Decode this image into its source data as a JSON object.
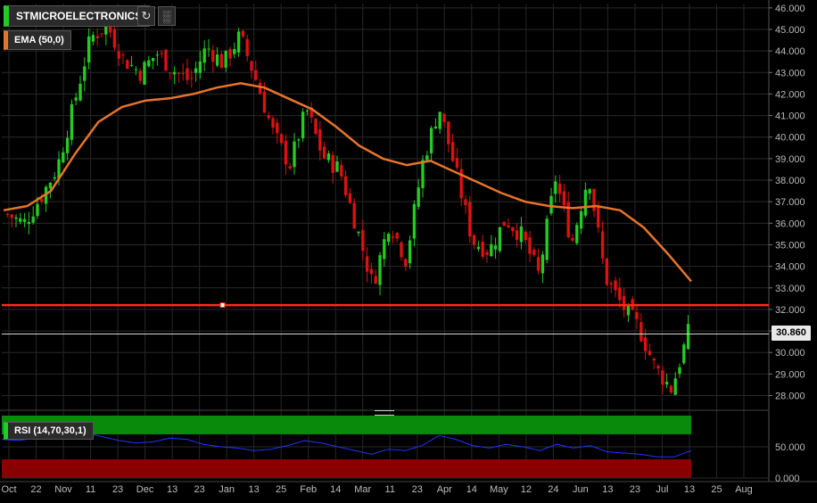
{
  "toolbar": {
    "symbol": "STMICROELECTRONICS",
    "refresh_icon": "refresh-icon",
    "chart_settings_icon": "chart-settings-icon",
    "accent": "#22cc22"
  },
  "indicators": {
    "ema_label": "EMA (50,0)",
    "ema_color": "#e8742a",
    "rsi_label": "RSI (14,70,30,1)",
    "rsi_color": "#2233ff"
  },
  "last_price_label": "30.860",
  "chart_data": [
    {
      "type": "candlestick",
      "title": "STMICROELECTRONICS",
      "y_axis_side": "right",
      "ylim": [
        27.4,
        46.2
      ],
      "y_ticks": [
        "28.000",
        "29.000",
        "30.000",
        "31.000",
        "32.000",
        "33.000",
        "34.000",
        "35.000",
        "36.000",
        "37.000",
        "38.000",
        "39.000",
        "40.000",
        "41.000",
        "42.000",
        "43.000",
        "44.000",
        "45.000",
        "46.000"
      ],
      "x_tick_labels": [
        "Oct",
        "22",
        "Nov",
        "11",
        "23",
        "Dec",
        "13",
        "23",
        "Jan",
        "13",
        "25",
        "Feb",
        "14",
        "Mar",
        "11",
        "23",
        "Apr",
        "14",
        "May",
        "12",
        "24",
        "Jun",
        "13",
        "23",
        "Jul",
        "13",
        "25",
        "Aug"
      ],
      "up_color": "#22cc22",
      "down_color": "#dd1111",
      "grid": true,
      "horizontal_level": 32.2,
      "horizontal_level_color": "#ff2a1a",
      "last_price": 30.86,
      "close_path_points": [
        36.4,
        36.0,
        37.2,
        38.6,
        41.5,
        44.6,
        45.2,
        43.6,
        43.0,
        43.9,
        43.1,
        42.6,
        44.2,
        43.4,
        44.7,
        42.6,
        40.2,
        38.7,
        41.3,
        39.1,
        38.5,
        35.9,
        33.1,
        36.1,
        34.3,
        38.8,
        41.4,
        38.4,
        35.2,
        34.7,
        36.2,
        35.4,
        33.6,
        38.1,
        35.1,
        38.3,
        33.5,
        32.2,
        31.2,
        29.3,
        28.3,
        30.9
      ],
      "ema_path_points": [
        36.6,
        36.8,
        37.5,
        39.2,
        40.7,
        41.4,
        41.7,
        41.8,
        42.0,
        42.3,
        42.5,
        42.3,
        41.8,
        41.3,
        40.5,
        39.6,
        39.0,
        38.7,
        38.9,
        38.4,
        37.9,
        37.4,
        37.0,
        36.8,
        36.7,
        36.8,
        36.6,
        35.8,
        34.6,
        33.3
      ]
    },
    {
      "type": "line",
      "title": "RSI (14,70,30,1)",
      "ylim": [
        0,
        100
      ],
      "y_ticks": [
        "50.000",
        "0.000"
      ],
      "overbought": 70,
      "oversold": 30,
      "overbought_zone_color": "#0a8a0a",
      "oversold_zone_color": "#8a0000",
      "line_color": "#2233ff",
      "values": [
        62,
        60,
        64,
        70,
        74,
        72,
        66,
        60,
        56,
        58,
        64,
        62,
        54,
        50,
        48,
        44,
        46,
        52,
        60,
        56,
        50,
        44,
        38,
        46,
        44,
        52,
        68,
        62,
        52,
        48,
        54,
        50,
        44,
        54,
        48,
        52,
        42,
        40,
        38,
        34,
        34,
        44
      ]
    }
  ]
}
